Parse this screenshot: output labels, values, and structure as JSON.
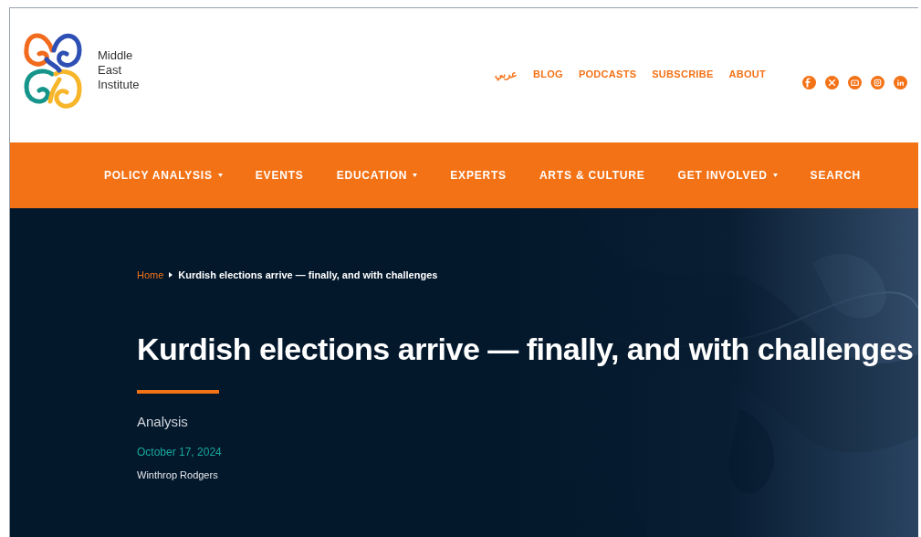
{
  "logo": {
    "text_lines": [
      "Middle",
      "East",
      "Institute"
    ]
  },
  "top_links": [
    {
      "label": "عربي"
    },
    {
      "label": "BLOG"
    },
    {
      "label": "PODCASTS"
    },
    {
      "label": "SUBSCRIBE"
    },
    {
      "label": "ABOUT"
    }
  ],
  "social_links": [
    {
      "kind": "facebook"
    },
    {
      "kind": "x"
    },
    {
      "kind": "youtube"
    },
    {
      "kind": "instagram"
    },
    {
      "kind": "linkedin"
    }
  ],
  "nav": [
    {
      "label": "POLICY ANALYSIS",
      "has_dropdown": true
    },
    {
      "label": "EVENTS",
      "has_dropdown": false
    },
    {
      "label": "EDUCATION",
      "has_dropdown": true
    },
    {
      "label": "EXPERTS",
      "has_dropdown": false
    },
    {
      "label": "ARTS & CULTURE",
      "has_dropdown": false
    },
    {
      "label": "GET INVOLVED",
      "has_dropdown": true
    },
    {
      "label": "SEARCH",
      "has_dropdown": false
    }
  ],
  "hero": {
    "breadcrumb": [
      {
        "label": "Home",
        "link": true
      },
      {
        "label": "Kurdish elections arrive — finally, and with challenges",
        "link": false
      }
    ],
    "title": "Kurdish elections arrive — finally, and with challenges",
    "type": "Analysis",
    "date": "October 17, 2024",
    "author": "Winthrop Rodgers"
  }
}
